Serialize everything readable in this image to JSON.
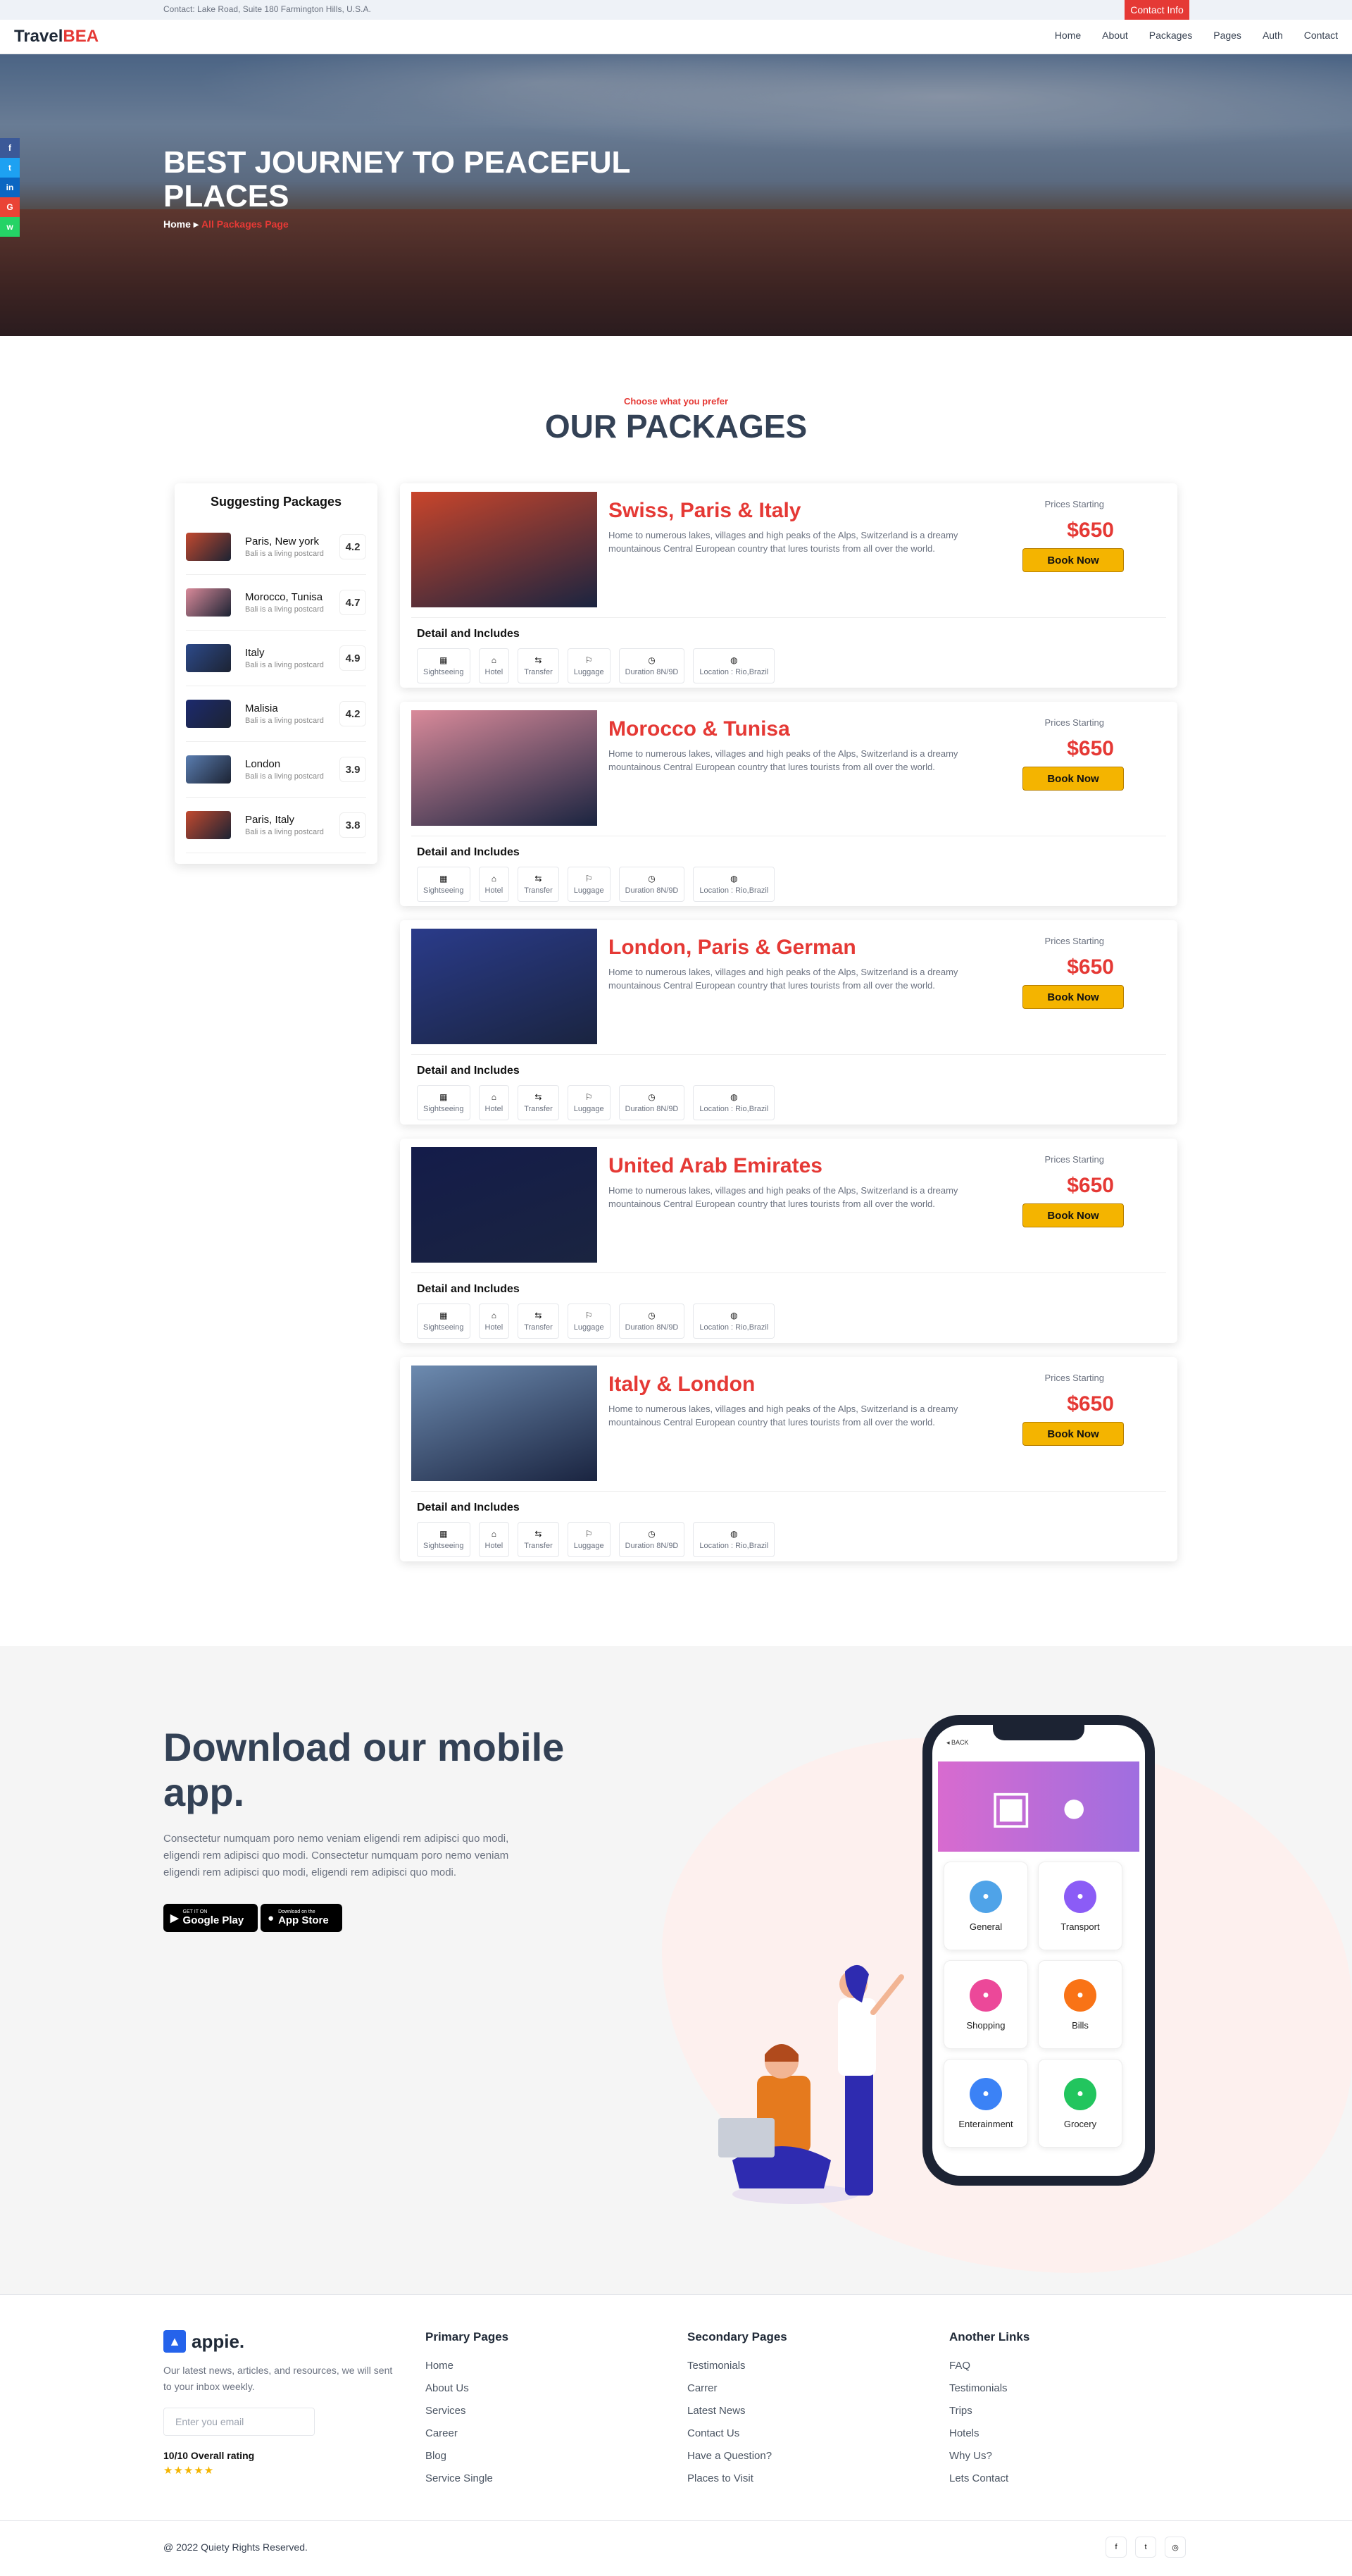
{
  "topbar": {
    "contact": "Contact: Lake Road, Suite 180 Farmington Hills, U.S.A.",
    "button": "Contact Info"
  },
  "brand": {
    "part1": "Travel",
    "part2": "BEA"
  },
  "nav": [
    "Home",
    "About",
    "Packages",
    "Pages",
    "Auth",
    "Contact"
  ],
  "hero": {
    "title": "BEST JOURNEY TO PEACEFUL PLACES",
    "crumb_home": "Home",
    "crumb_sep": "▸",
    "crumb_current": "All Packages Page"
  },
  "social": [
    {
      "glyph": "f",
      "name": "facebook-icon",
      "color": "#3b5998"
    },
    {
      "glyph": "t",
      "name": "twitter-icon",
      "color": "#1da1f2"
    },
    {
      "glyph": "in",
      "name": "linkedin-icon",
      "color": "#0a66c2"
    },
    {
      "glyph": "G",
      "name": "google-icon",
      "color": "#ea4335"
    },
    {
      "glyph": "w",
      "name": "whatsapp-icon",
      "color": "#25d366"
    }
  ],
  "section": {
    "subtitle": "Choose what you prefer",
    "title": "OUR PACKAGES"
  },
  "sidebar": {
    "title": "Suggesting Packages",
    "items": [
      {
        "name": "Paris, New york",
        "sub": "Bali is a living postcard",
        "rating": "4.2",
        "color": "#c2492f"
      },
      {
        "name": "Morocco, Tunisa",
        "sub": "Bali is a living postcard",
        "rating": "4.7",
        "color": "#d98a9a"
      },
      {
        "name": "Italy",
        "sub": "Bali is a living postcard",
        "rating": "4.9",
        "color": "#2d4a8a"
      },
      {
        "name": "Malisia",
        "sub": "Bali is a living postcard",
        "rating": "4.2",
        "color": "#1c2a6e"
      },
      {
        "name": "London",
        "sub": "Bali is a living postcard",
        "rating": "3.9",
        "color": "#5a7db0"
      },
      {
        "name": "Paris, Italy",
        "sub": "Bali is a living postcard",
        "rating": "3.8",
        "color": "#c2492f"
      }
    ]
  },
  "packages": [
    {
      "title": "Swiss, Paris & Italy",
      "color": "#c9452b",
      "desc": "Home to numerous lakes, villages and high peaks of the Alps, Switzerland is a dreamy mountainous Central European country that lures tourists from all over the world.",
      "price_label": "Prices Starting",
      "price": "$650",
      "button": "Book Now",
      "detail": "Detail and Includes"
    },
    {
      "title": "Morocco & Tunisa",
      "color": "#d98a9a",
      "desc": "Home to numerous lakes, villages and high peaks of the Alps, Switzerland is a dreamy mountainous Central European country that lures tourists from all over the world.",
      "price_label": "Prices Starting",
      "price": "$650",
      "button": "Book Now",
      "detail": "Detail and Includes"
    },
    {
      "title": "London, Paris & German",
      "color": "#2a3b8a",
      "desc": "Home to numerous lakes, villages and high peaks of the Alps, Switzerland is a dreamy mountainous Central European country that lures tourists from all over the world.",
      "price_label": "Prices Starting",
      "price": "$650",
      "button": "Book Now",
      "detail": "Detail and Includes"
    },
    {
      "title": "United Arab Emirates",
      "color": "#141c4a",
      "desc": "Home to numerous lakes, villages and high peaks of the Alps, Switzerland is a dreamy mountainous Central European country that lures tourists from all over the world.",
      "price_label": "Prices Starting",
      "price": "$650",
      "button": "Book Now",
      "detail": "Detail and Includes"
    },
    {
      "title": "Italy & London",
      "color": "#6d8bb0",
      "desc": "Home to numerous lakes, villages and high peaks of the Alps, Switzerland is a dreamy mountainous Central European country that lures tourists from all over the world.",
      "price_label": "Prices Starting",
      "price": "$650",
      "button": "Book Now",
      "detail": "Detail and Includes"
    }
  ],
  "features": [
    {
      "label": "Sightseeing",
      "icon": "▦",
      "name": "sightseeing-icon"
    },
    {
      "label": "Hotel",
      "icon": "⌂",
      "name": "hotel-icon"
    },
    {
      "label": "Transfer",
      "icon": "⇆",
      "name": "transfer-icon"
    },
    {
      "label": "Luggage",
      "icon": "⚐",
      "name": "luggage-icon"
    },
    {
      "label": "Duration 8N/9D",
      "icon": "◷",
      "name": "clock-icon"
    },
    {
      "label": "Location : Rio,Brazil",
      "icon": "◍",
      "name": "globe-icon"
    }
  ],
  "app": {
    "title": "Download our mobile app.",
    "desc": "Consectetur numquam poro nemo veniam eligendi rem adipisci quo modi, eligendi rem adipisci quo modi. Consectetur numquam poro nemo veniam eligendi rem adipisci quo modi, eligendi rem adipisci quo modi.",
    "google_small": "GET IT ON",
    "google": "Google Play",
    "apple_small": "Download on the",
    "apple": "App Store",
    "phone_back": "◂ BACK",
    "tiles": [
      {
        "label": "General",
        "color": "#4fa3e8"
      },
      {
        "label": "Transport",
        "color": "#8b5cf6"
      },
      {
        "label": "Shopping",
        "color": "#ec4899"
      },
      {
        "label": "Bills",
        "color": "#f97316"
      },
      {
        "label": "Enterainment",
        "color": "#3b82f6"
      },
      {
        "label": "Grocery",
        "color": "#22c55e"
      }
    ]
  },
  "footer": {
    "logo": "appie.",
    "text": "Our latest news, articles, and resources, we will sent to your inbox weekly.",
    "email_placeholder": "Enter you email",
    "rating": "10/10 Overall rating",
    "stars": "★★★★★",
    "cols": [
      {
        "title": "Primary Pages",
        "links": [
          "Home",
          "About Us",
          "Services",
          "Career",
          "Blog",
          "Service Single"
        ]
      },
      {
        "title": "Secondary Pages",
        "links": [
          "Testimonials",
          "Carrer",
          "Latest News",
          "Contact Us",
          "Have a Question?",
          "Places to Visit"
        ]
      },
      {
        "title": "Another Links",
        "links": [
          "FAQ",
          "Testimonials",
          "Trips",
          "Hotels",
          "Why Us?",
          "Lets Contact"
        ]
      }
    ],
    "copyright": "@ 2022 Quiety Rights Reserved.",
    "icons": [
      "f",
      "t",
      "◎"
    ]
  }
}
